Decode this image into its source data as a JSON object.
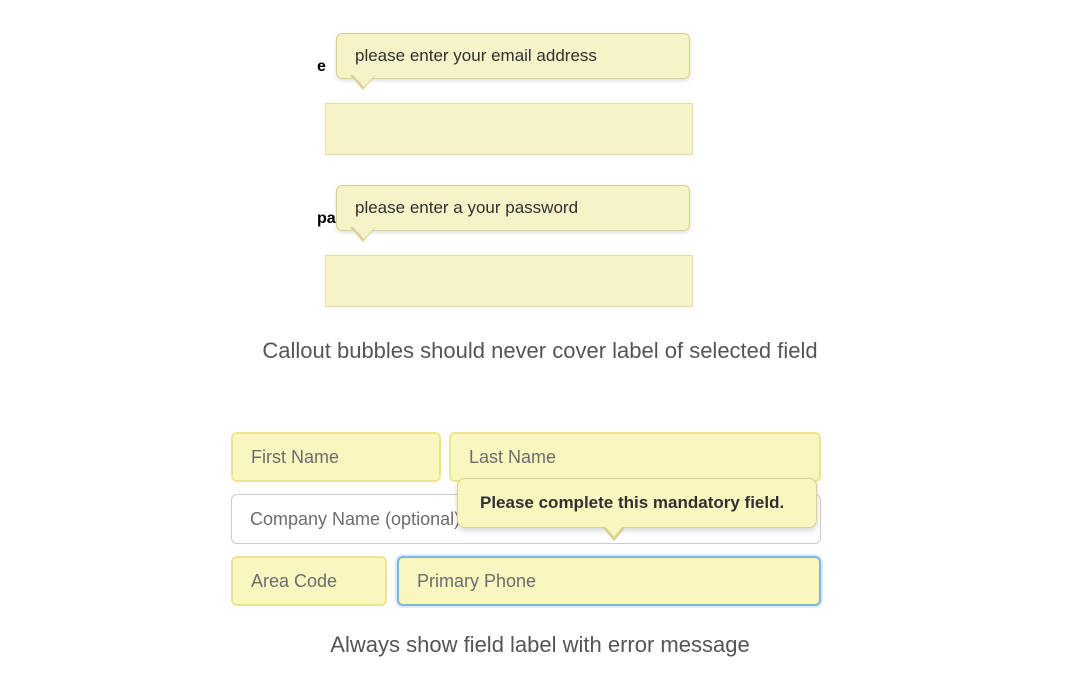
{
  "top": {
    "email_label": "email",
    "email_label_partial": "e",
    "password_label": "password",
    "password_label_partial": "pa",
    "callout_email": "please enter your email address",
    "callout_password": "please enter a your password"
  },
  "caption1": "Callout bubbles should never cover label of selected field",
  "fields": {
    "first_name": "First Name",
    "last_name": "Last Name",
    "company": "Company Name (optional)",
    "area_code": "Area Code",
    "primary_phone": "Primary Phone"
  },
  "error_bubble": "Please complete this mandatory field.",
  "caption2": "Always show field label with error message"
}
